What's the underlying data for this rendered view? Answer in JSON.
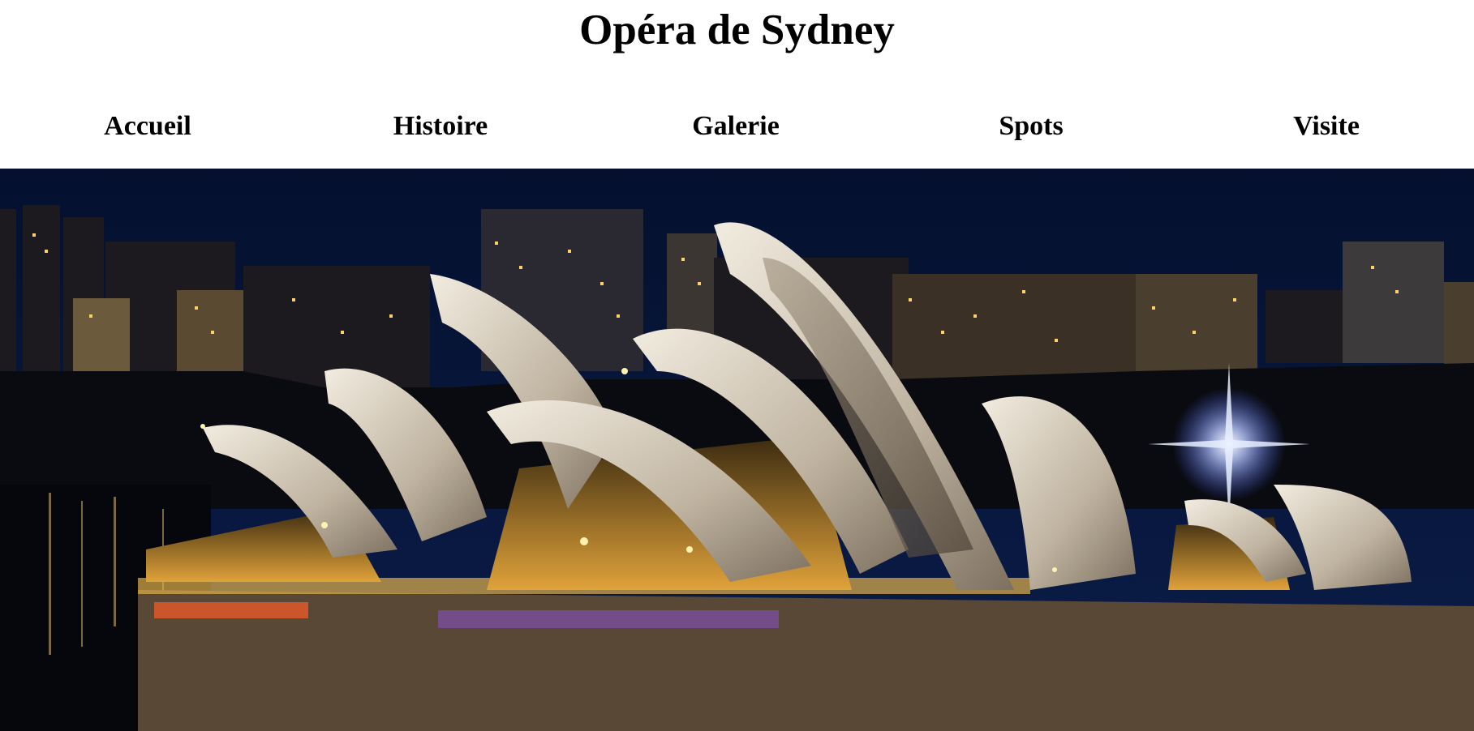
{
  "page": {
    "title": "Opéra de Sydney"
  },
  "nav": {
    "items": [
      {
        "label": "Accueil"
      },
      {
        "label": "Histoire"
      },
      {
        "label": "Galerie"
      },
      {
        "label": "Spots"
      },
      {
        "label": "Visite"
      }
    ]
  },
  "hero": {
    "subject": "sydney-opera-house-night-photo",
    "colors": {
      "sky": "#06123a",
      "water": "#05070c",
      "shell": "#d9d1c3",
      "lights": "#ffc84a"
    }
  }
}
